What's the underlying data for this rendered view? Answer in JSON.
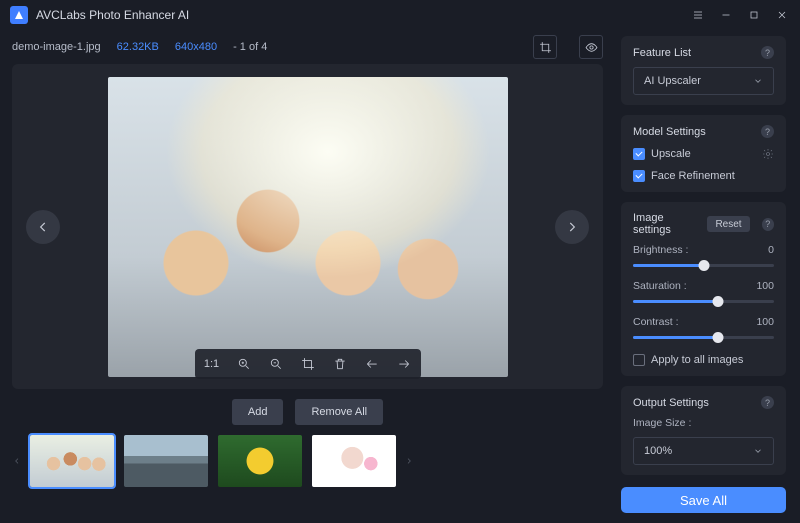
{
  "app": {
    "title": "AVCLabs Photo Enhancer AI"
  },
  "file": {
    "name": "demo-image-1.jpg",
    "size": "62.32KB",
    "dims": "640x480",
    "index": "- 1 of 4"
  },
  "toolbar": {
    "ratio": "1:1"
  },
  "filmbar": {
    "add": "Add",
    "remove": "Remove All"
  },
  "sidebar": {
    "feature": {
      "title": "Feature List",
      "selected": "AI Upscaler"
    },
    "model": {
      "title": "Model Settings",
      "upscale": "Upscale",
      "face": "Face Refinement"
    },
    "image": {
      "title": "Image settings",
      "reset": "Reset",
      "brightness": {
        "label": "Brightness :",
        "value": 0,
        "pct": 50
      },
      "saturation": {
        "label": "Saturation :",
        "value": 100,
        "pct": 60
      },
      "contrast": {
        "label": "Contrast :",
        "value": 100,
        "pct": 60
      },
      "applyAll": "Apply to all images"
    },
    "output": {
      "title": "Output Settings",
      "sizeLabel": "Image Size :",
      "size": "100%"
    },
    "save": "Save All"
  }
}
